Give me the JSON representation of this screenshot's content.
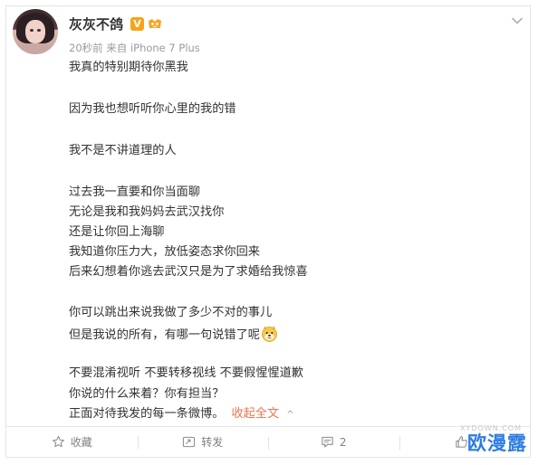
{
  "post": {
    "username": "灰灰不鸽",
    "verified_mark": "V",
    "meta": "20秒前 来自 iPhone 7 Plus",
    "lines": [
      "我真的特别期待你黑我",
      "因为我也想听听你心里的我的错",
      "我不是不讲道理的人",
      "过去我一直要和你当面聊",
      "无论是我和我妈妈去武汉找你",
      "还是让你回上海聊",
      "我知道你压力大，放低姿态求你回来",
      "后来幻想着你逃去武汉只是为了求婚给我惊喜",
      "你可以跳出来说我做了多少不对的事儿",
      "但是我说的所有，有哪一句说错了呢",
      "不要混淆视听 不要转移视线 不要假惺惺道歉",
      "你说的什么来着？你有担当？",
      "正面对待我发的每一条微博。"
    ],
    "collapse_label": "收起全文",
    "collapse_caret": "^"
  },
  "actions": {
    "favorite_label": "收藏",
    "repost_label": "转发",
    "comment_count": "2"
  },
  "watermark": {
    "text": "欧漫露",
    "faint": "XYDOWN.COM"
  },
  "icons": {
    "avatar": "avatar-photo",
    "verified": "orange-v-badge",
    "level": "vip-level-icon",
    "menu": "chevron-down-icon",
    "emoji": "doge-emoji-icon",
    "favorite": "star-icon",
    "repost": "repost-icon",
    "comment": "comment-icon",
    "like": "thumb-up-icon"
  },
  "colors": {
    "text": "#333333",
    "meta": "#9a9a9a",
    "link": "#eb7350",
    "badge": "#f7a41b",
    "watermark": "#2f7de1"
  }
}
